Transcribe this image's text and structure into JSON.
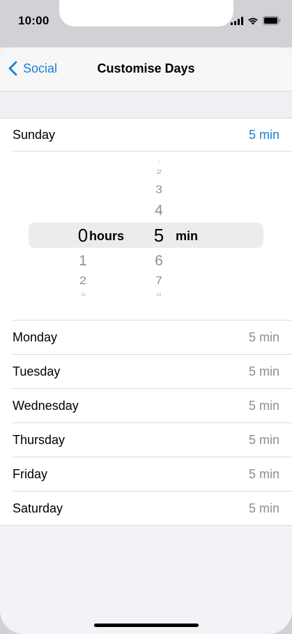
{
  "status_bar": {
    "time": "10:00"
  },
  "nav": {
    "back_label": "Social",
    "title": "Customise Days"
  },
  "days": [
    {
      "name": "Sunday",
      "value": "5 min"
    },
    {
      "name": "Monday",
      "value": "5 min"
    },
    {
      "name": "Tuesday",
      "value": "5 min"
    },
    {
      "name": "Wednesday",
      "value": "5 min"
    },
    {
      "name": "Thursday",
      "value": "5 min"
    },
    {
      "name": "Friday",
      "value": "5 min"
    },
    {
      "name": "Saturday",
      "value": "5 min"
    }
  ],
  "picker": {
    "hours": {
      "selected": "0",
      "unit": "hours",
      "below": [
        "1",
        "2",
        "3"
      ]
    },
    "minutes": {
      "selected": "5",
      "unit": "min",
      "above": [
        "1",
        "2",
        "3",
        "4"
      ],
      "below": [
        "6",
        "7",
        "8"
      ]
    }
  },
  "colors": {
    "accent": "#1a7fd4",
    "secondary_text": "#8e8e93",
    "background": "#f2f2f7"
  },
  "icons": {
    "back": "chevron-left-icon",
    "signal": "cellular-signal-icon",
    "wifi": "wifi-icon",
    "battery": "battery-icon"
  }
}
